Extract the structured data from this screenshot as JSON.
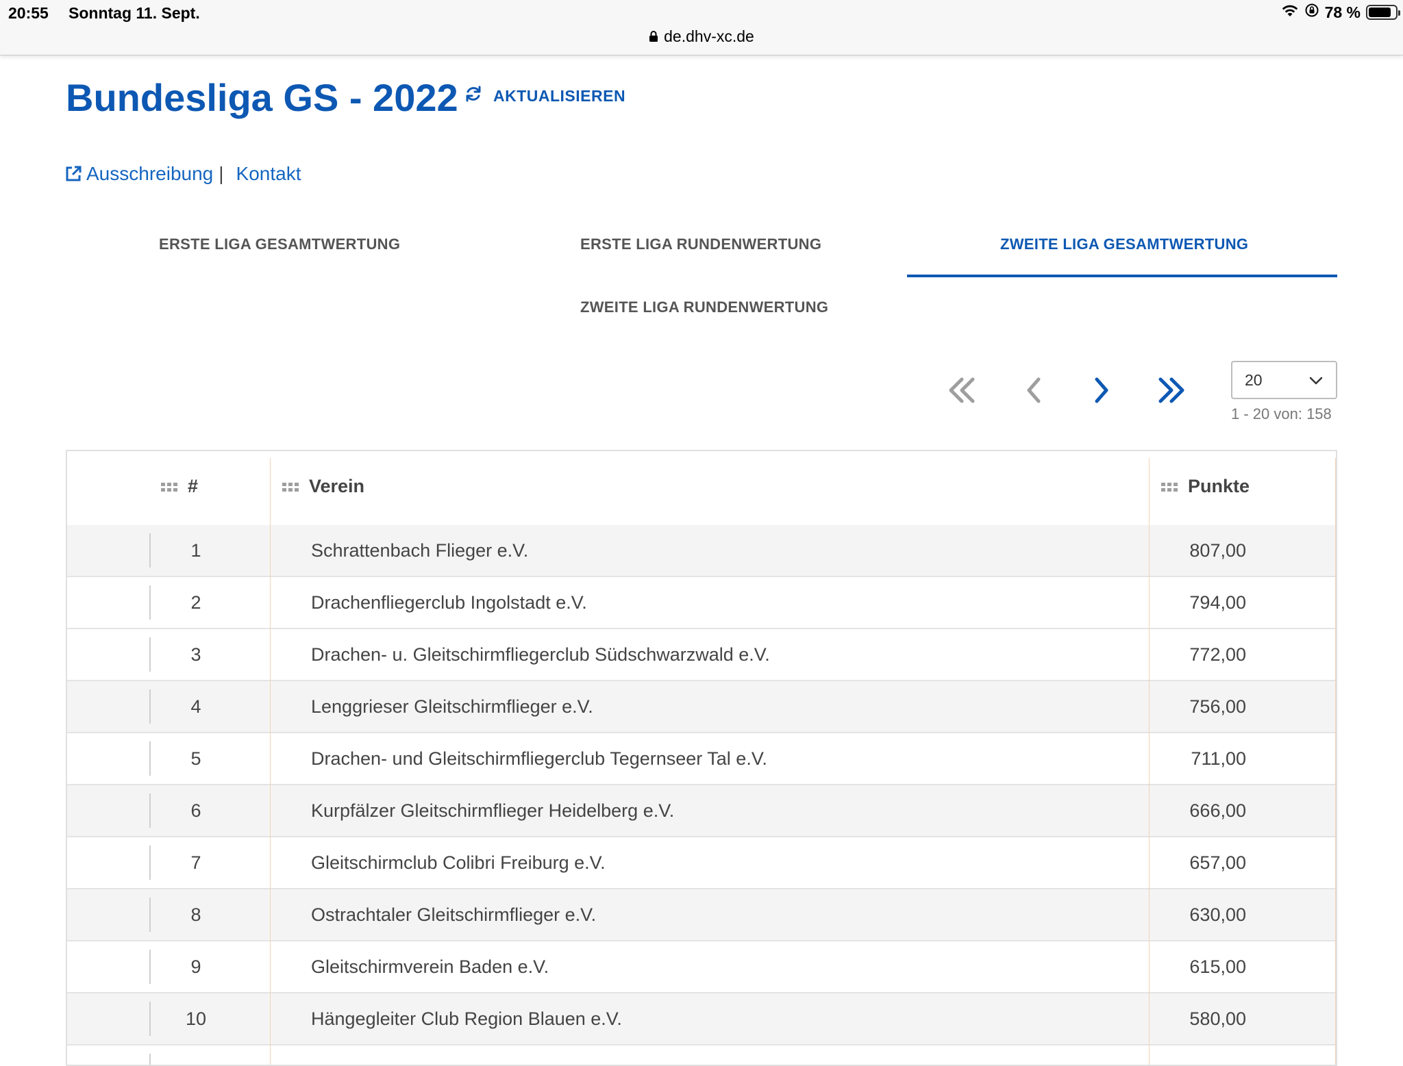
{
  "status_bar": {
    "time": "20:55",
    "date": "Sonntag 11. Sept.",
    "battery": "78 %",
    "url": "de.dhv-xc.de"
  },
  "header": {
    "title": "Bundesliga GS - 2022",
    "refresh_label": "AKTUALISIEREN"
  },
  "links": {
    "announcement": "Ausschreibung",
    "separator": "|",
    "contact": "Kontakt"
  },
  "tabs": [
    {
      "label": "ERSTE LIGA GESAMTWERTUNG",
      "active": false
    },
    {
      "label": "ERSTE LIGA RUNDENWERTUNG",
      "active": false
    },
    {
      "label": "ZWEITE LIGA GESAMTWERTUNG",
      "active": true
    },
    {
      "label": "ZWEITE LIGA RUNDENWERTUNG",
      "active": false
    }
  ],
  "pager": {
    "page_size": "20",
    "range": "1 - 20 von: 158"
  },
  "table": {
    "columns": [
      "#",
      "Verein",
      "Punkte"
    ],
    "rows": [
      {
        "rank": "1",
        "club": "Schrattenbach Flieger e.V.",
        "points": "807,00"
      },
      {
        "rank": "2",
        "club": "Drachenfliegerclub Ingolstadt e.V.",
        "points": "794,00"
      },
      {
        "rank": "3",
        "club": "Drachen- u. Gleitschirmfliegerclub Südschwarzwald e.V.",
        "points": "772,00"
      },
      {
        "rank": "4",
        "club": "Lenggrieser Gleitschirmflieger e.V.",
        "points": "756,00"
      },
      {
        "rank": "5",
        "club": "Drachen- und Gleitschirmfliegerclub Tegernseer Tal e.V.",
        "points": "711,00"
      },
      {
        "rank": "6",
        "club": "Kurpfälzer Gleitschirmflieger Heidelberg e.V.",
        "points": "666,00"
      },
      {
        "rank": "7",
        "club": "Gleitschirmclub Colibri Freiburg e.V.",
        "points": "657,00"
      },
      {
        "rank": "8",
        "club": "Ostrachtaler Gleitschirmflieger e.V.",
        "points": "630,00"
      },
      {
        "rank": "9",
        "club": "Gleitschirmverein Baden e.V.",
        "points": "615,00"
      },
      {
        "rank": "10",
        "club": "Hängegleiter Club Region Blauen e.V.",
        "points": "580,00"
      }
    ]
  },
  "colors": {
    "brand_blue": "#0d58b3",
    "link_blue": "#1565c0",
    "row_stripe": "#f4f4f4",
    "column_divider": "#f3d2b4"
  }
}
